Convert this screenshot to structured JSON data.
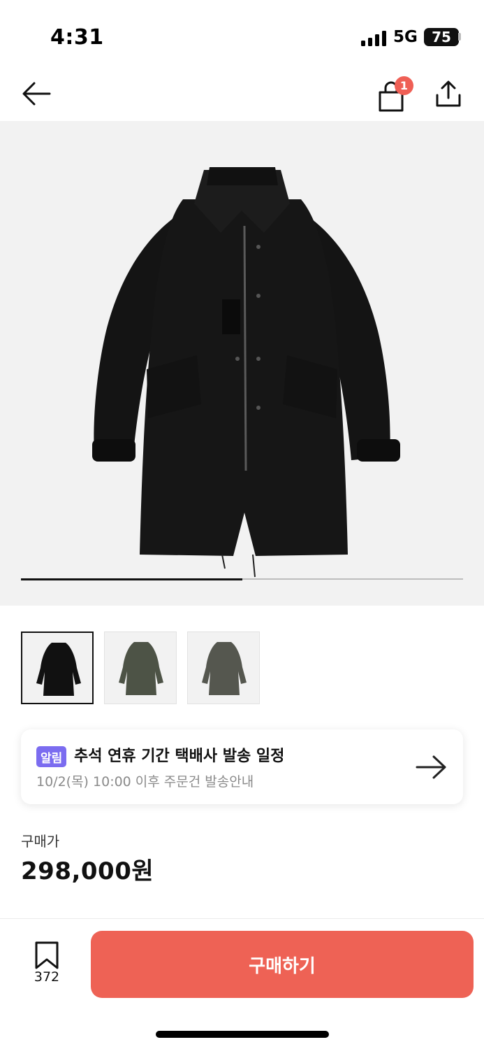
{
  "status_bar": {
    "time": "4:31",
    "network": "5G",
    "battery": "75"
  },
  "header": {
    "back_icon": "arrow-left-icon",
    "bag_icon": "shopping-bag-icon",
    "bag_badge": "1",
    "share_icon": "share-icon"
  },
  "gallery": {
    "progress": 0.5,
    "thumbnails": [
      {
        "color": "#111111",
        "active": true
      },
      {
        "color": "#4d5346",
        "active": false
      },
      {
        "color": "#55574f",
        "active": false
      }
    ]
  },
  "notice": {
    "badge": "알림",
    "title": "추석 연휴 기간 택배사 발송 일정",
    "subtitle": "10/2(목) 10:00 이후 주문건 발송안내",
    "arrow_icon": "arrow-right-icon"
  },
  "price": {
    "label": "구매가",
    "value": "298,000원"
  },
  "bottom_bar": {
    "bookmark_icon": "bookmark-icon",
    "bookmark_count": "372",
    "buy_label": "구매하기"
  },
  "colors": {
    "accent": "#ee6255",
    "badge": "#ef5f55",
    "notice_badge": "#7b6cf0"
  }
}
